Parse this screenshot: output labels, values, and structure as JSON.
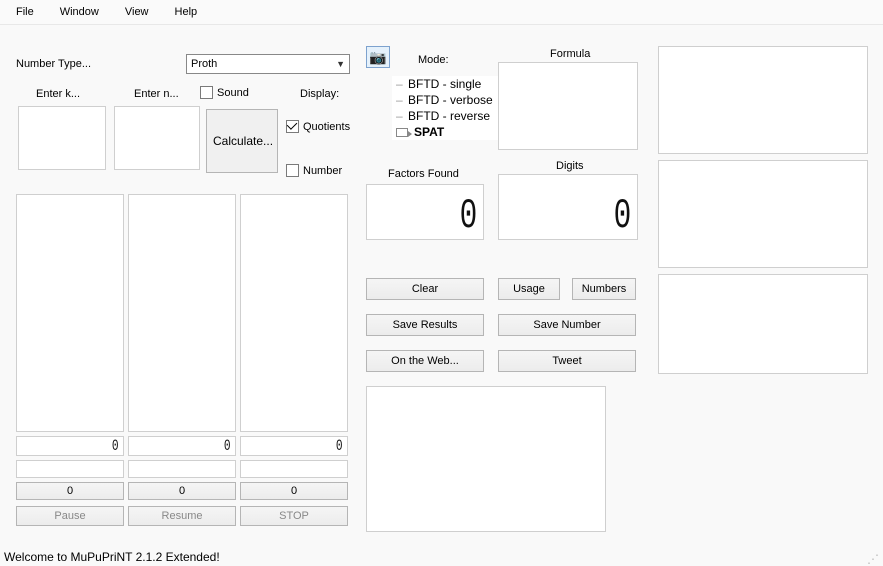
{
  "menu": {
    "file": "File",
    "window": "Window",
    "view": "View",
    "help": "Help"
  },
  "labels": {
    "number_type": "Number Type...",
    "enter_k": "Enter k...",
    "enter_n": "Enter n...",
    "sound": "Sound",
    "display": "Display:",
    "quotients": "Quotients",
    "number": "Number",
    "calculate": "Calculate...",
    "mode": "Mode:",
    "factors_found": "Factors Found",
    "formula": "Formula",
    "digits": "Digits"
  },
  "number_type": {
    "selected": "Proth"
  },
  "mode_tree": {
    "items": [
      "BFTD - single",
      "BFTD - verbose",
      "BFTD - reverse",
      "SPAT"
    ],
    "selected_index": 3
  },
  "counters": {
    "factors_found": "0",
    "digits": "0",
    "lcd_a": "0",
    "lcd_b": "0",
    "lcd_c": "0",
    "prog_a": "0",
    "prog_b": "0",
    "prog_c": "0"
  },
  "checkboxes": {
    "sound": false,
    "quotients": true,
    "number": false
  },
  "buttons": {
    "clear": "Clear",
    "usage": "Usage",
    "numbers": "Numbers",
    "save_results": "Save Results",
    "save_number": "Save Number",
    "on_web": "On the Web...",
    "tweet": "Tweet",
    "pause": "Pause",
    "resume": "Resume",
    "stop": "STOP"
  },
  "status": "Welcome to MuPuPriNT 2.1.2 Extended!"
}
